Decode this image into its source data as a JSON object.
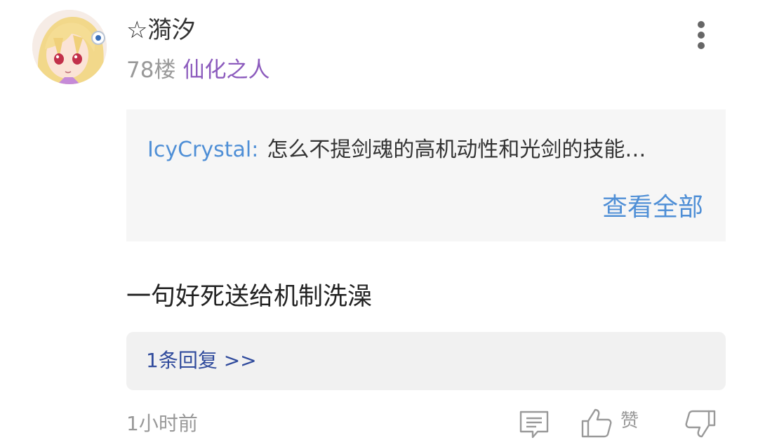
{
  "post": {
    "username": "☆漪汐",
    "floor": "78楼",
    "user_level": "仙化之人",
    "avatar_icon": "anime-girl-avatar-icon",
    "more_icon": "more-vertical-icon",
    "quote": {
      "author": "IcyCrystal:",
      "text": "怎么不提剑魂的高机动性和光剑的技能…",
      "view_all": "查看全部"
    },
    "comment": "一句好死送给机制洗澡",
    "replies_label": "1条回复 >>",
    "timestamp": "1小时前",
    "actions": {
      "reply_icon": "comment-icon",
      "like_icon": "thumbs-up-icon",
      "like_label": "赞",
      "dislike_icon": "thumbs-down-icon"
    }
  },
  "colors": {
    "link_blue": "#4f8fd6",
    "level_purple": "#8c5bbd",
    "reply_blue": "#2f4a9c",
    "muted_gray": "#999999",
    "quote_bg": "#f6f6f6"
  }
}
